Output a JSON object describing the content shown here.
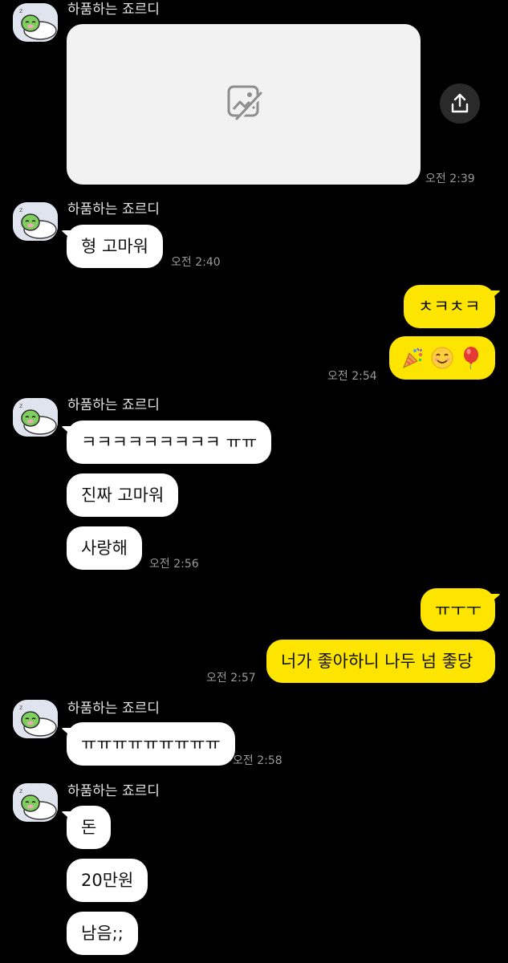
{
  "sender_name": "하품하는 죠르디",
  "icons": {
    "avatar": "jordy-avatar",
    "image_placeholder": "broken-image-icon",
    "share": "share-icon",
    "party": "party-popper-emoji",
    "smile": "smiling-face-emoji",
    "balloon": "balloon-emoji"
  },
  "colors": {
    "background": "#000000",
    "incoming_bubble": "#ffffff",
    "outgoing_bubble": "#fee500",
    "timestamp": "#9a9a9a"
  },
  "messages": {
    "g1": {
      "time": "오전 2:39"
    },
    "g2": {
      "text": "형 고마워",
      "time": "오전 2:40"
    },
    "g3": {
      "text": "ㅊㅋㅊㅋ",
      "time": "오전 2:54"
    },
    "g4": {
      "texts": [
        "ㅋㅋㅋㅋㅋㅋㅋㅋㅋ ㅠㅠ",
        "진짜 고마워",
        "사랑해"
      ],
      "time": "오전 2:56"
    },
    "g5": {
      "texts": [
        "ㅠㅜㅜ",
        "너가 좋아하니 나두 넘 좋당"
      ],
      "time": "오전 2:57"
    },
    "g6": {
      "text": "ㅠㅠㅠㅠㅠㅠㅠㅠㅠ",
      "time": "오전 2:58"
    },
    "g7": {
      "texts": [
        "돈",
        "20만원",
        "남음;;"
      ]
    }
  }
}
